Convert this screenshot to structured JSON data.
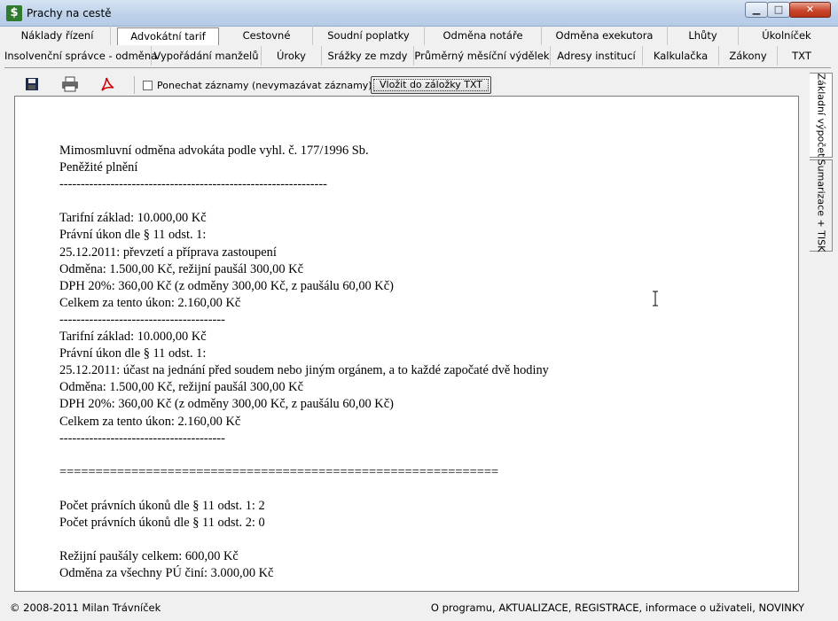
{
  "window": {
    "title": "Prachy na cestě",
    "icon_glyph": "$",
    "minimize_glyph": "▁",
    "maximize_glyph": "□",
    "close_glyph": "✕"
  },
  "tabs_row1": [
    "Náklady řízení",
    "Advokátní tarif",
    "Cestovné",
    "Soudní poplatky",
    "Odměna notáře",
    "Odměna exekutora",
    "Lhůty",
    "Úkolníček"
  ],
  "tabs_row2": [
    "Insolvenční správce - odměna",
    "Vypořádání manželů",
    "Úroky",
    "Srážky ze mzdy",
    "Průměrný měsíční výdělek",
    "Adresy institucí",
    "Kalkulačka",
    "Zákony",
    "TXT"
  ],
  "active_tab": "Advokátní tarif",
  "toolbar": {
    "icons": [
      "save-icon",
      "print-icon",
      "pdf-icon"
    ],
    "keep_records_label": "Ponechat záznamy (nevymazávat záznamy)",
    "keep_records_checked": false,
    "insert_button_label": "Vložit do záložky TXT"
  },
  "side_tabs": [
    "Základní výpočet",
    "Sumarizace + TISK"
  ],
  "text_lines": [
    "Mimosmluvní odměna advokáta podle vyhl. č. 177/1996 Sb.",
    "Peněžité plnění",
    "---------------------------------------------------------------",
    "",
    "Tarifní základ: 10.000,00 Kč",
    "Právní úkon dle § 11 odst. 1:",
    "25.12.2011: převzetí a příprava zastoupení",
    "Odměna: 1.500,00 Kč, režijní paušál 300,00 Kč",
    "DPH 20%: 360,00 Kč (z odměny 300,00 Kč, z paušálu 60,00 Kč)",
    "Celkem za tento úkon: 2.160,00 Kč",
    "---------------------------------------",
    "Tarifní základ: 10.000,00 Kč",
    "Právní úkon dle § 11 odst. 1:",
    "25.12.2011: účast na jednání před soudem nebo jiným orgánem, a to každé započaté dvě hodiny",
    "Odměna: 1.500,00 Kč, režijní paušál 300,00 Kč",
    "DPH 20%: 360,00 Kč (z odměny 300,00 Kč, z paušálu 60,00 Kč)",
    "Celkem za tento úkon: 2.160,00 Kč",
    "---------------------------------------",
    "",
    "=============================================================",
    "",
    "Počet právních úkonů dle § 11 odst. 1: 2",
    "Počet právních úkonů dle § 11 odst. 2: 0",
    "",
    "Režijní paušály celkem: 600,00 Kč",
    "Odměna za všechny PÚ činí: 3.000,00 Kč"
  ],
  "status": {
    "left": "© 2008-2011 Milan Trávníček",
    "right": "O programu, AKTUALIZACE, REGISTRACE, informace o uživateli, NOVINKY"
  }
}
